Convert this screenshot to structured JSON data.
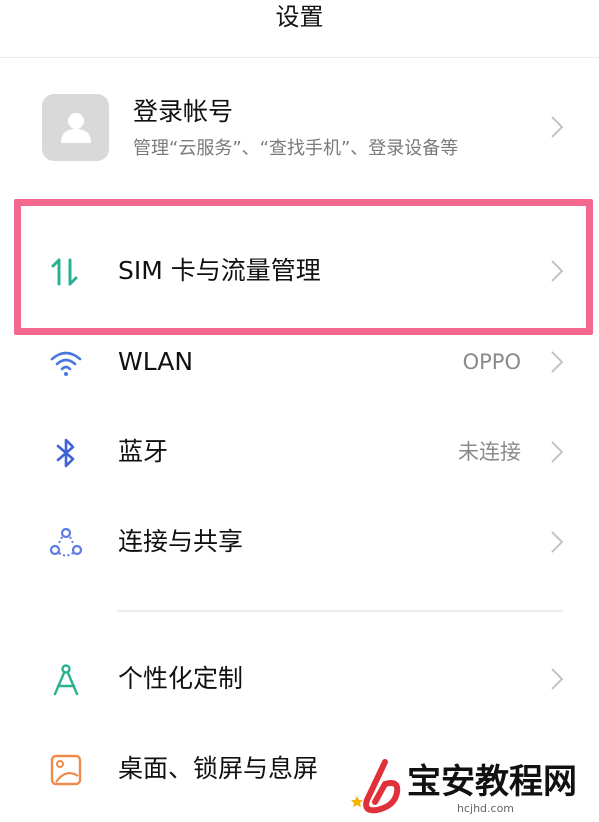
{
  "header": {
    "title": "设置"
  },
  "account": {
    "name": "登录帐号",
    "description": "管理“云服务”、“查找手机”、登录设备等"
  },
  "rows": [
    {
      "label": "SIM 卡与流量管理",
      "value": "",
      "icon": "sim-data-icon"
    },
    {
      "label": "WLAN",
      "value": "OPPO",
      "icon": "wifi-icon"
    },
    {
      "label": "蓝牙",
      "value": "未连接",
      "icon": "bluetooth-icon"
    },
    {
      "label": "连接与共享",
      "value": "",
      "icon": "connection-share-icon"
    },
    {
      "label": "个性化定制",
      "value": "",
      "icon": "personalization-icon"
    },
    {
      "label": "桌面、锁屏与息屏",
      "value": "",
      "icon": "wallpaper-icon"
    }
  ],
  "highlight_color": "#f3698e",
  "watermark": {
    "text": "宝安教程网",
    "domain": "hcjhd.com"
  }
}
